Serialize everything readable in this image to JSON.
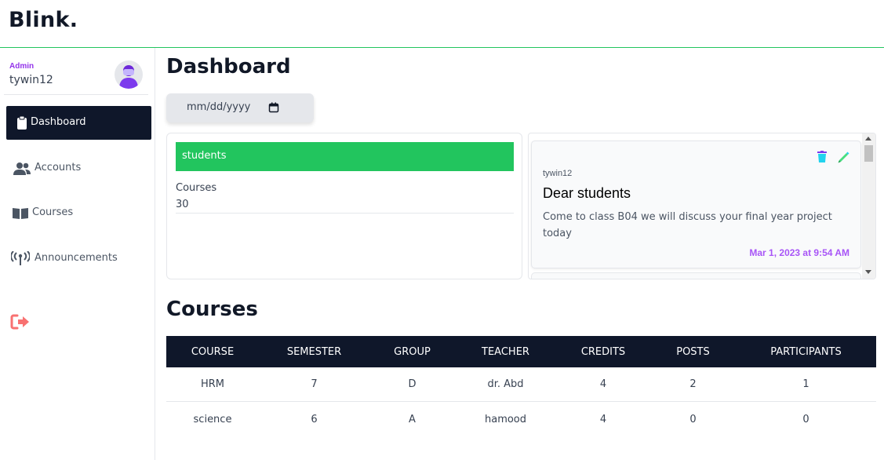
{
  "app": {
    "brand": "Blink."
  },
  "user": {
    "role": "Admin",
    "username": "tywin12"
  },
  "sidebar": {
    "items": [
      {
        "label": "Dashboard",
        "icon": "clipboard-icon",
        "active": true
      },
      {
        "label": "Accounts",
        "icon": "users-icon",
        "active": false
      },
      {
        "label": "Courses",
        "icon": "book-icon",
        "active": false
      },
      {
        "label": "Announcements",
        "icon": "broadcast-icon",
        "active": false
      }
    ],
    "logout_icon": "logout-icon"
  },
  "dashboard": {
    "title": "Dashboard",
    "date_placeholder": "mm/dd/yyyy",
    "stats": {
      "header": "students",
      "label": "Courses",
      "value": "30"
    }
  },
  "announcement": {
    "author": "tywin12",
    "title": "Dear students",
    "body": "Come to class B04 we will discuss your final year project today",
    "date": "Mar 1, 2023 at 9:54 AM"
  },
  "courses": {
    "title": "Courses",
    "columns": [
      "COURSE",
      "SEMESTER",
      "GROUP",
      "TEACHER",
      "CREDITS",
      "POSTS",
      "PARTICIPANTS"
    ],
    "rows": [
      [
        "HRM",
        "7",
        "D",
        "dr. Abd",
        "4",
        "2",
        "1"
      ],
      [
        "science",
        "6",
        "A",
        "hamood",
        "4",
        "0",
        "0"
      ]
    ]
  },
  "colors": {
    "accent_green": "#22c55e",
    "nav_active": "#0f172a",
    "role_purple": "#9333ea",
    "date_purple": "#a855f7",
    "logout_red": "#f87171"
  }
}
